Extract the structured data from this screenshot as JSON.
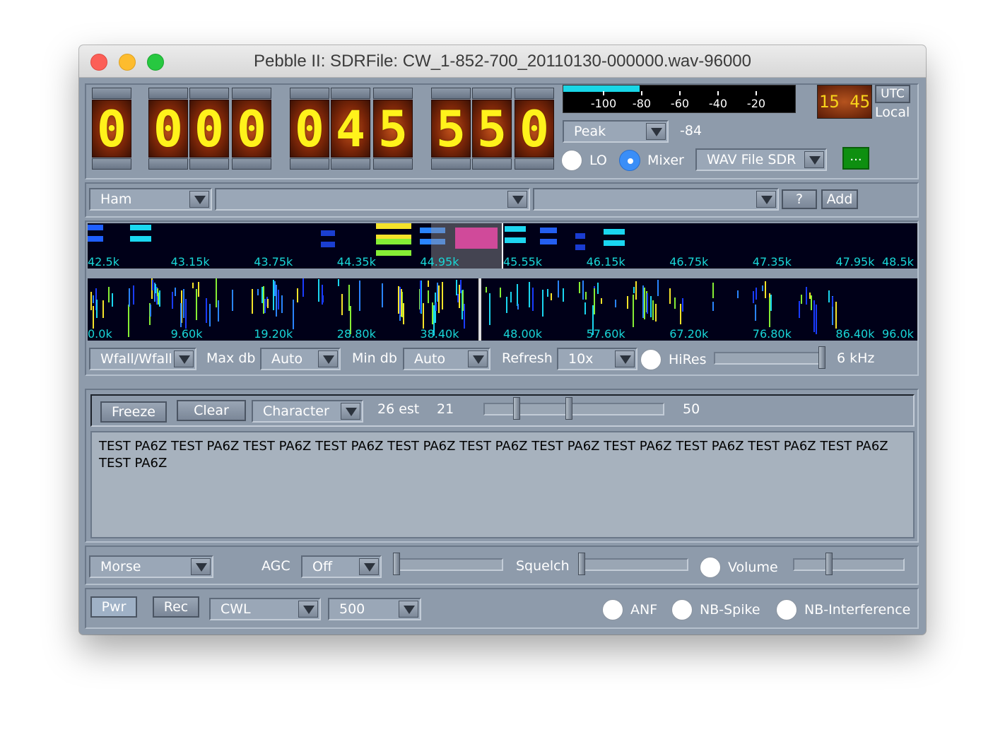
{
  "window": {
    "title": "Pebble II: SDRFile: CW_1-852-700_20110130-000000.wav-96000"
  },
  "frequency": {
    "digits": [
      "0",
      "0",
      "0",
      "0",
      "0",
      "4",
      "5",
      "5",
      "5",
      "0"
    ]
  },
  "smeter": {
    "ticks": [
      "-100",
      "-80",
      "-60",
      "-40",
      "-20"
    ],
    "level": 0.36,
    "mode": "Peak",
    "reading": "-84"
  },
  "clock": {
    "time": "15 45",
    "utc_label": "UTC",
    "local_label": "Local"
  },
  "source": {
    "lo_label": "LO",
    "mixer_label": "Mixer",
    "selected": "Mixer",
    "device": "WAV File SDR",
    "more_label": "..."
  },
  "bands": {
    "band": "Ham",
    "sub1": "",
    "sub2": "",
    "help_label": "?",
    "add_label": "Add"
  },
  "waterfall": {
    "top_ticks": [
      "42.5k",
      "43.15k",
      "43.75k",
      "44.35k",
      "44.95k",
      "45.55k",
      "46.15k",
      "46.75k",
      "47.35k",
      "47.95k",
      "48.5k"
    ],
    "bottom_ticks": [
      "0.0k",
      "9.60k",
      "19.20k",
      "28.80k",
      "38.40k",
      "48.00k",
      "57.60k",
      "67.20k",
      "76.80k",
      "86.40k",
      "96.0k"
    ]
  },
  "display_controls": {
    "mode": "Wfall/Wfall",
    "max_db_label": "Max db",
    "max_db": "Auto",
    "min_db_label": "Min db",
    "min_db": "Auto",
    "refresh_label": "Refresh",
    "refresh": "10x",
    "hires_label": "HiRes",
    "span": "6 kHz"
  },
  "decoder": {
    "freeze_label": "Freeze",
    "clear_label": "Clear",
    "unit": "Character",
    "est": "26 est",
    "wpm": "21",
    "max": "50",
    "text": "TEST PA6Z TEST PA6Z TEST PA6Z TEST PA6Z TEST PA6Z TEST PA6Z TEST PA6Z TEST PA6Z TEST PA6Z TEST PA6Z TEST PA6Z TEST PA6Z"
  },
  "audio": {
    "decoder_mode": "Morse",
    "agc_label": "AGC",
    "agc": "Off",
    "squelch_label": "Squelch",
    "volume_label": "Volume"
  },
  "bottom": {
    "pwr_label": "Pwr",
    "rec_label": "Rec",
    "mode": "CWL",
    "bandwidth": "500",
    "anf_label": "ANF",
    "nb_spike_label": "NB-Spike",
    "nb_interference_label": "NB-Interference"
  }
}
